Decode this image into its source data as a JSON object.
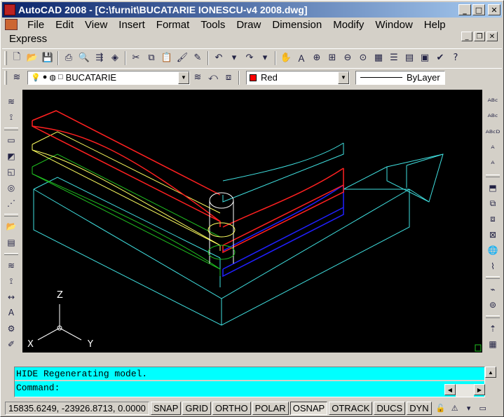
{
  "title_bar": {
    "title": "AutoCAD 2008 - [C:\\furnit\\BUCATARIE IONESCU-v4 2008.dwg]"
  },
  "window_controls": {
    "minimize": "_",
    "maximize": "□",
    "close": "✕"
  },
  "document_controls": {
    "minimize": "_",
    "restore": "❐",
    "close": "✕"
  },
  "menus": [
    "File",
    "Edit",
    "View",
    "Insert",
    "Format",
    "Tools",
    "Draw",
    "Dimension",
    "Modify",
    "Window",
    "Help"
  ],
  "menu_express": "Express",
  "layer_toolbar": {
    "current_layer": "BUCATARIE"
  },
  "properties_toolbar": {
    "color": "Red",
    "color_hex": "#ff0000",
    "linetype": "ByLayer"
  },
  "ucs": {
    "z": "Z",
    "x": "X",
    "y": "Y"
  },
  "command": {
    "history": "HIDE Regenerating model.",
    "prompt": "Command:"
  },
  "status": {
    "coordinates": "15835.6249, -23926.8713, 0.0000",
    "toggles": [
      {
        "label": "SNAP",
        "on": false
      },
      {
        "label": "GRID",
        "on": false
      },
      {
        "label": "ORTHO",
        "on": false
      },
      {
        "label": "POLAR",
        "on": false
      },
      {
        "label": "OSNAP",
        "on": true
      },
      {
        "label": "OTRACK",
        "on": false
      },
      {
        "label": "DUCS",
        "on": false
      },
      {
        "label": "DYN",
        "on": false
      }
    ]
  },
  "drawing_colors": {
    "red": "#ff2020",
    "yellow": "#ffff60",
    "green": "#20c020",
    "cyan": "#40e0e0",
    "blue": "#2020ff",
    "white": "#ffffff"
  }
}
